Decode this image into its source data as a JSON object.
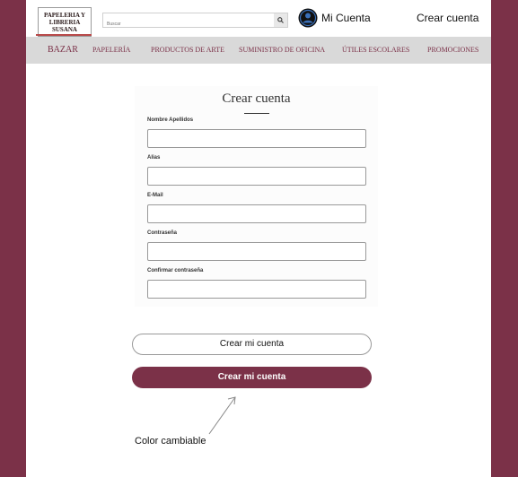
{
  "header": {
    "logo_line1": "PAPELERIA Y",
    "logo_line2": "LIBRERIA",
    "logo_line3": "SUSANA",
    "search_placeholder": "Buscar",
    "account_label": "Mi Cuenta",
    "create_account_link": "Crear cuenta"
  },
  "nav": {
    "items": [
      "BAZAR",
      "PAPELERÍA",
      "PRODUCTOS DE ARTE",
      "SUMINISTRO DE OFICINA",
      "ÚTILES ESCOLARES",
      "PROMOCIONES"
    ]
  },
  "form": {
    "title": "Crear cuenta",
    "fields": [
      {
        "label": "Nombre Apellidos",
        "value": ""
      },
      {
        "label": "Alias",
        "value": ""
      },
      {
        "label": "E-Mail",
        "value": ""
      },
      {
        "label": "Contraseña",
        "value": ""
      },
      {
        "label": "Confirmar contraseña",
        "value": ""
      }
    ]
  },
  "buttons": {
    "outline_label": "Crear mi cuenta",
    "filled_label": "Crear mi cuenta"
  },
  "annotation": {
    "text": "Color cambiable"
  },
  "colors": {
    "brand": "#7b3148",
    "nav_bg": "#d9d9d9",
    "page_bg": "#ffffff"
  }
}
